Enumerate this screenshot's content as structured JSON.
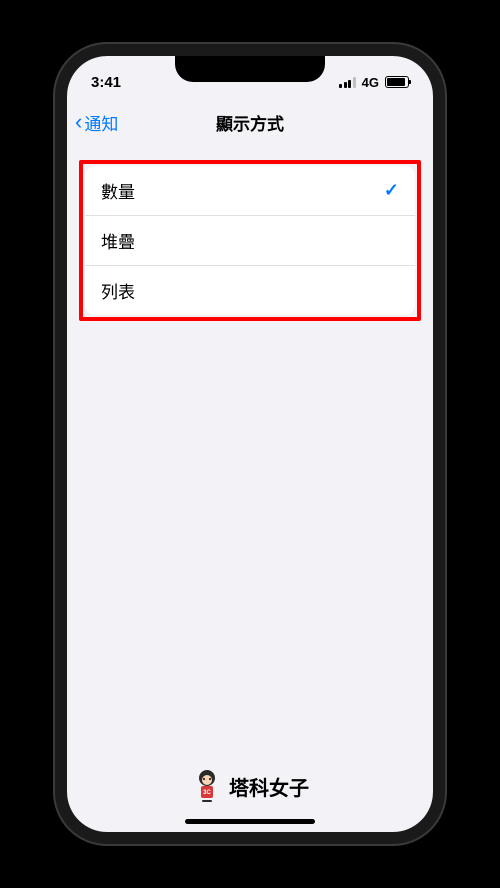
{
  "status_bar": {
    "time": "3:41",
    "network": "4G"
  },
  "nav": {
    "back_label": "通知",
    "title": "顯示方式"
  },
  "options": [
    {
      "label": "數量",
      "selected": true
    },
    {
      "label": "堆疊",
      "selected": false
    },
    {
      "label": "列表",
      "selected": false
    }
  ],
  "watermark": {
    "text": "塔科女子"
  }
}
